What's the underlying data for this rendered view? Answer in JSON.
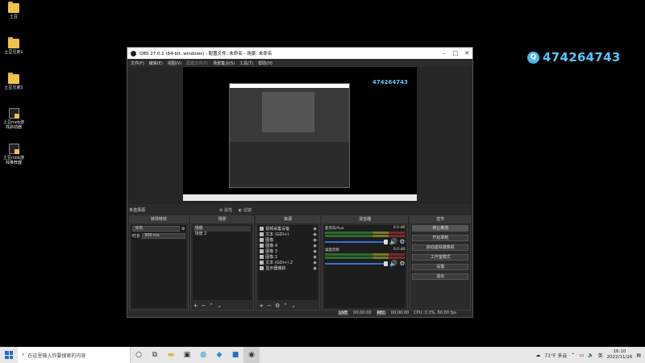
{
  "desktop": {
    "icons": [
      {
        "label": "土豆"
      },
      {
        "label": "土豆兄弟1"
      },
      {
        "label": "土豆兄弟2"
      },
      {
        "label": "土豆mob游戏启动器"
      },
      {
        "label": "土豆mob游戏推荐器"
      }
    ],
    "qq_number": "474264743"
  },
  "obs": {
    "title": "OBS 27.0.1 (64-bit, windows) - 配置文件: 未命名 - 场景: 未命名",
    "menu": [
      "文件(F)",
      "编辑(E)",
      "视图(V)",
      "配置文件(P)",
      "场景集合(S)",
      "工具(T)",
      "帮助(H)"
    ],
    "preview_qq": "474264743",
    "no_source_label": "未选择源",
    "props_button": "属性",
    "filters_button": "滤镜",
    "docks": {
      "transitions": {
        "title": "转场特效",
        "type": "淡出",
        "duration_label": "时长",
        "duration_value": "300 ms"
      },
      "scenes": {
        "title": "场景",
        "items": [
          "场景",
          "场景 2"
        ]
      },
      "sources": {
        "title": "来源",
        "items": [
          {
            "name": "视频采集设备",
            "icon": "camera-icon"
          },
          {
            "name": "文本 (GDI+)",
            "icon": "text-icon"
          },
          {
            "name": "图像",
            "icon": "image-icon"
          },
          {
            "name": "图像 4",
            "icon": "image-icon"
          },
          {
            "name": "图像 3",
            "icon": "image-icon"
          },
          {
            "name": "图像 2",
            "icon": "image-icon"
          },
          {
            "name": "文本 (GDI+) 2",
            "icon": "text-icon"
          },
          {
            "name": "显示器捕获",
            "icon": "monitor-icon"
          }
        ]
      },
      "mixer": {
        "title": "混音器",
        "channels": [
          {
            "name": "桌面音频",
            "db": "0.0 dB"
          },
          {
            "name": "麦克风/Aux",
            "db": "0.0 dB"
          }
        ]
      },
      "controls": {
        "title": "控件",
        "buttons": [
          "停止推流",
          "开始录制",
          "启动虚拟摄像机",
          "工作室模式",
          "设置",
          "退出"
        ]
      }
    },
    "status": {
      "live_tag": "LIVE",
      "live_time": "00:00:00",
      "rec_tag": "REC",
      "rec_time": "00:00:00",
      "cpu": "CPU: 0.3%, 60.00 fps"
    }
  },
  "taskbar": {
    "search_placeholder": "在这里输入你要搜索的内容",
    "weather": "71°F 多云",
    "lang": "英",
    "time": "16:10",
    "date": "2022/11/26"
  }
}
